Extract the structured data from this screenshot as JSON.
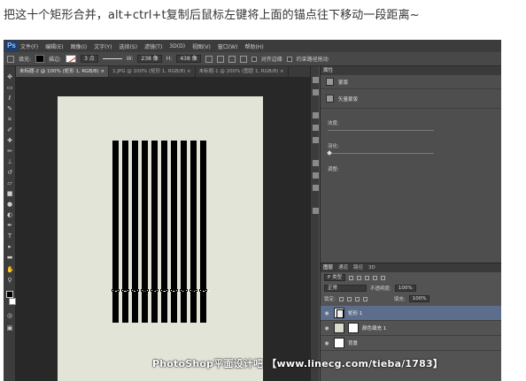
{
  "caption": "把这十个矩形合并，alt+ctrl+t复制后鼠标左键将上面的锚点往下移动一段距离~",
  "app": {
    "logo": "Ps",
    "menu": [
      "文件(F)",
      "编辑(E)",
      "图像(I)",
      "文字(Y)",
      "选择(S)",
      "滤镜(T)",
      "3D(D)",
      "视图(V)",
      "窗口(W)",
      "帮助(H)"
    ]
  },
  "options_bar": {
    "fill_label": "填充:",
    "stroke_label": "描边:",
    "stroke_width": "3 点",
    "w_label": "W:",
    "w_value": "238 像",
    "h_label": "H:",
    "h_value": "438 像",
    "align_edges": "对齐边缘",
    "auto_add_delete": "约束路径拖动"
  },
  "document_tabs": [
    {
      "label": "未标题-2 @ 100% (矩形 1, RGB/8) ×",
      "active": true
    },
    {
      "label": "1.JPG @ 100% (矩形 1, RGB/8) ×",
      "active": false
    },
    {
      "label": "未标题-1 @ 200% (图层 1, RGB/8) ×",
      "active": false
    }
  ],
  "properties": {
    "tab": "属性",
    "mask_label": "蒙版",
    "vector_mask_label": "矢量蒙版",
    "density_label": "浓度:",
    "feather_label": "羽化:",
    "refine_label": "调整:"
  },
  "layers_panel": {
    "tabs": [
      "图层",
      "通道",
      "路径",
      "3D"
    ],
    "filter_kind": "P 类型",
    "blend_mode": "正常",
    "opacity_label": "不透明度:",
    "opacity_value": "100%",
    "lock_label": "锁定:",
    "fill_label": "填充:",
    "fill_value": "100%",
    "layers": [
      {
        "name": "矩形 1",
        "selected": true,
        "thumb": "shape"
      },
      {
        "name": "颜色填充 1",
        "selected": false,
        "thumb": "fill"
      },
      {
        "name": "背景",
        "selected": false,
        "thumb": "background"
      }
    ]
  },
  "canvas": {
    "bar_count": 10
  },
  "watermark": "PhotoShop平面设计吧 【www.linecg.com/tieba/1783】"
}
